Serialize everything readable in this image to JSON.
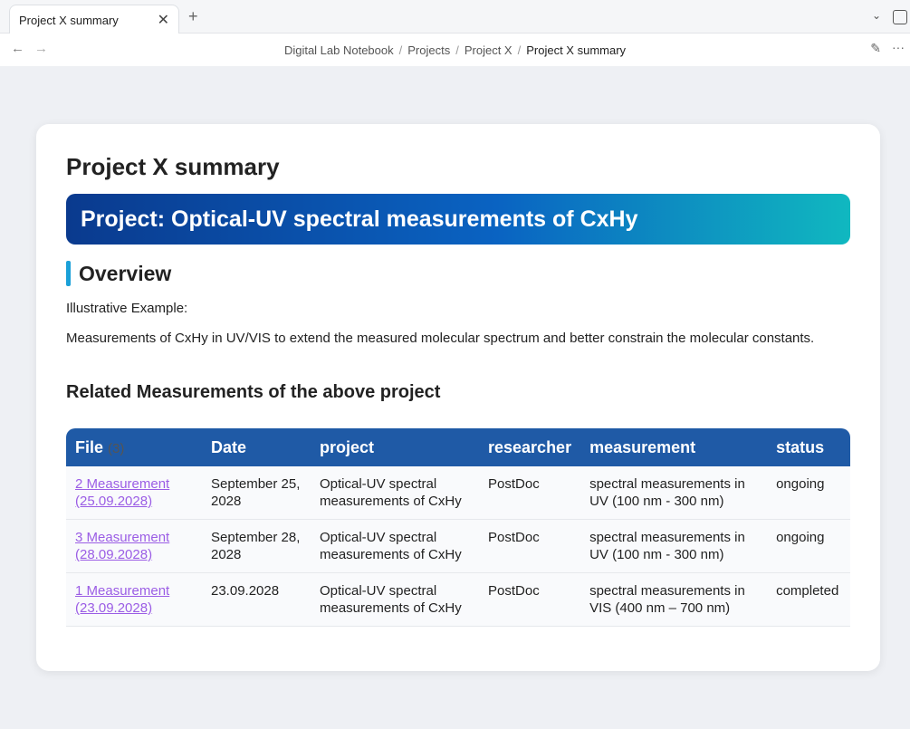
{
  "tab": {
    "title": "Project X summary"
  },
  "breadcrumb": [
    "Digital Lab Notebook",
    "Projects",
    "Project X",
    "Project X summary"
  ],
  "page": {
    "title": "Project X summary",
    "banner": "Project: Optical-UV spectral measurements of CxHy",
    "overview": "Overview",
    "intro": "Illustrative Example:",
    "description": "Measurements of CxHy in UV/VIS to extend the measured molecular spectrum and better constrain the molecular constants.",
    "related": "Related Measurements of the above project"
  },
  "table": {
    "headers": [
      "File",
      "Date",
      "project",
      "researcher",
      "measurement",
      "status"
    ],
    "count": "(3)",
    "rows": [
      [
        "2 Measurement (25.09.2028)",
        "September 25, 2028",
        "Optical-UV spectral measurements of CxHy",
        "PostDoc",
        "spectral measurements in UV (100 nm - 300 nm)",
        "ongoing"
      ],
      [
        "3 Measurement (28.09.2028)",
        "September 28, 2028",
        "Optical-UV spectral measurements of CxHy",
        "PostDoc",
        "spectral measurements in UV (100 nm - 300 nm)",
        "ongoing"
      ],
      [
        "1 Measurement (23.09.2028)",
        "23.09.2028",
        "Optical-UV spectral measurements of CxHy",
        "PostDoc",
        "spectral measurements in VIS (400 nm – 700 nm)",
        "completed"
      ]
    ]
  }
}
